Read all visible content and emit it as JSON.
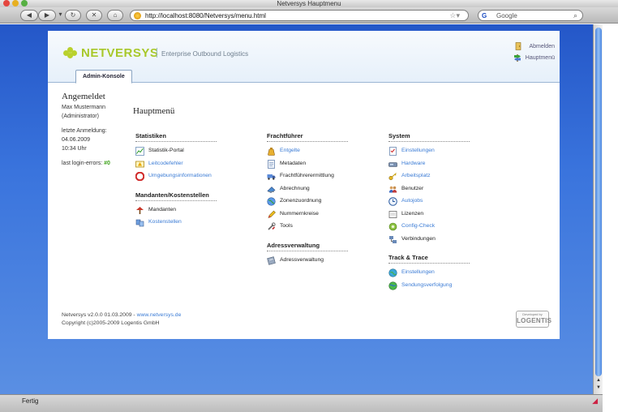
{
  "window": {
    "title": "Netversys Hauptmenu"
  },
  "browser": {
    "url": "http://localhost:8080/Netversys/menu.html",
    "search_placeholder": "Google",
    "search_engine": "G",
    "status": "Fertig"
  },
  "header": {
    "brand": "NETVERSYS",
    "subtitle": "Enterprise Outbound Logistics",
    "logout": "Abmelden",
    "mainmenu": "Hauptmenü",
    "tab": "Admin-Konsole"
  },
  "sidebar": {
    "heading": "Angemeldet",
    "user_name": "Max Mustermann",
    "role": "(Administrator)",
    "last_login_label": "letzte Anmeldung:",
    "last_login_date": "04.06.2009",
    "last_login_time": "10:34 Uhr",
    "errors_label": "last login-errors:",
    "errors_value": "#0"
  },
  "main": {
    "title": "Hauptmenü",
    "columns": [
      {
        "sections": [
          {
            "title": "Statistiken",
            "items": [
              {
                "label": "Statistik-Portal",
                "link": false,
                "icon": "chart-icon"
              },
              {
                "label": "Leitcodefehler",
                "link": true,
                "icon": "warning-sign-icon"
              },
              {
                "label": "Umgebungsinformationen",
                "link": true,
                "icon": "lifebuoy-icon"
              }
            ]
          },
          {
            "title": "Mandanten/Kostenstellen",
            "items": [
              {
                "label": "Mandanten",
                "link": false,
                "icon": "tree-icon"
              },
              {
                "label": "Kostenstellen",
                "link": true,
                "icon": "cost-center-icon"
              }
            ]
          }
        ]
      },
      {
        "sections": [
          {
            "title": "Frachtführer",
            "items": [
              {
                "label": "Entgelte",
                "link": true,
                "icon": "money-bag-icon"
              },
              {
                "label": "Metadaten",
                "link": false,
                "icon": "document-icon"
              },
              {
                "label": "Frachtführerermittlung",
                "link": false,
                "icon": "truck-icon"
              },
              {
                "label": "Abrechnung",
                "link": false,
                "icon": "calculator-icon"
              },
              {
                "label": "Zonenzuordnung",
                "link": false,
                "icon": "globe-icon"
              },
              {
                "label": "Nummernkreise",
                "link": false,
                "icon": "pencil-icon"
              },
              {
                "label": "Tools",
                "link": false,
                "icon": "tools-icon"
              }
            ]
          },
          {
            "title": "Adressverwaltung",
            "items": [
              {
                "label": "Adressverwaltung",
                "link": false,
                "icon": "address-book-icon"
              }
            ]
          }
        ]
      },
      {
        "sections": [
          {
            "title": "System",
            "items": [
              {
                "label": "Einstellungen",
                "link": true,
                "icon": "checklist-icon"
              },
              {
                "label": "Hardware",
                "link": true,
                "icon": "hardware-icon"
              },
              {
                "label": "Arbeitsplatz",
                "link": true,
                "icon": "key-icon"
              },
              {
                "label": "Benutzer",
                "link": false,
                "icon": "users-icon"
              },
              {
                "label": "Autojobs",
                "link": true,
                "icon": "clock-icon"
              },
              {
                "label": "Lizenzen",
                "link": false,
                "icon": "license-icon"
              },
              {
                "label": "Config-Check",
                "link": true,
                "icon": "config-icon"
              },
              {
                "label": "Verbindungen",
                "link": false,
                "icon": "connections-icon"
              }
            ]
          },
          {
            "title": "Track & Trace",
            "items": [
              {
                "label": "Einstellungen",
                "link": true,
                "icon": "globe-settings-icon"
              },
              {
                "label": "Sendungsverfolgung",
                "link": true,
                "icon": "tracking-globe-icon"
              }
            ]
          }
        ]
      }
    ]
  },
  "footer": {
    "version": "Netversys v2.0.0 01.03.2009 - ",
    "website": "www.netversys.de",
    "copyright": "Copyright (c)2005-2009 Logentis GmbH"
  },
  "badge": {
    "small": "Developed by",
    "brand": "LOGENTIS"
  },
  "colors": {
    "brand_green": "#a8c82a",
    "link_blue": "#3a7bd5",
    "viewport_blue": "#2f67d3"
  }
}
